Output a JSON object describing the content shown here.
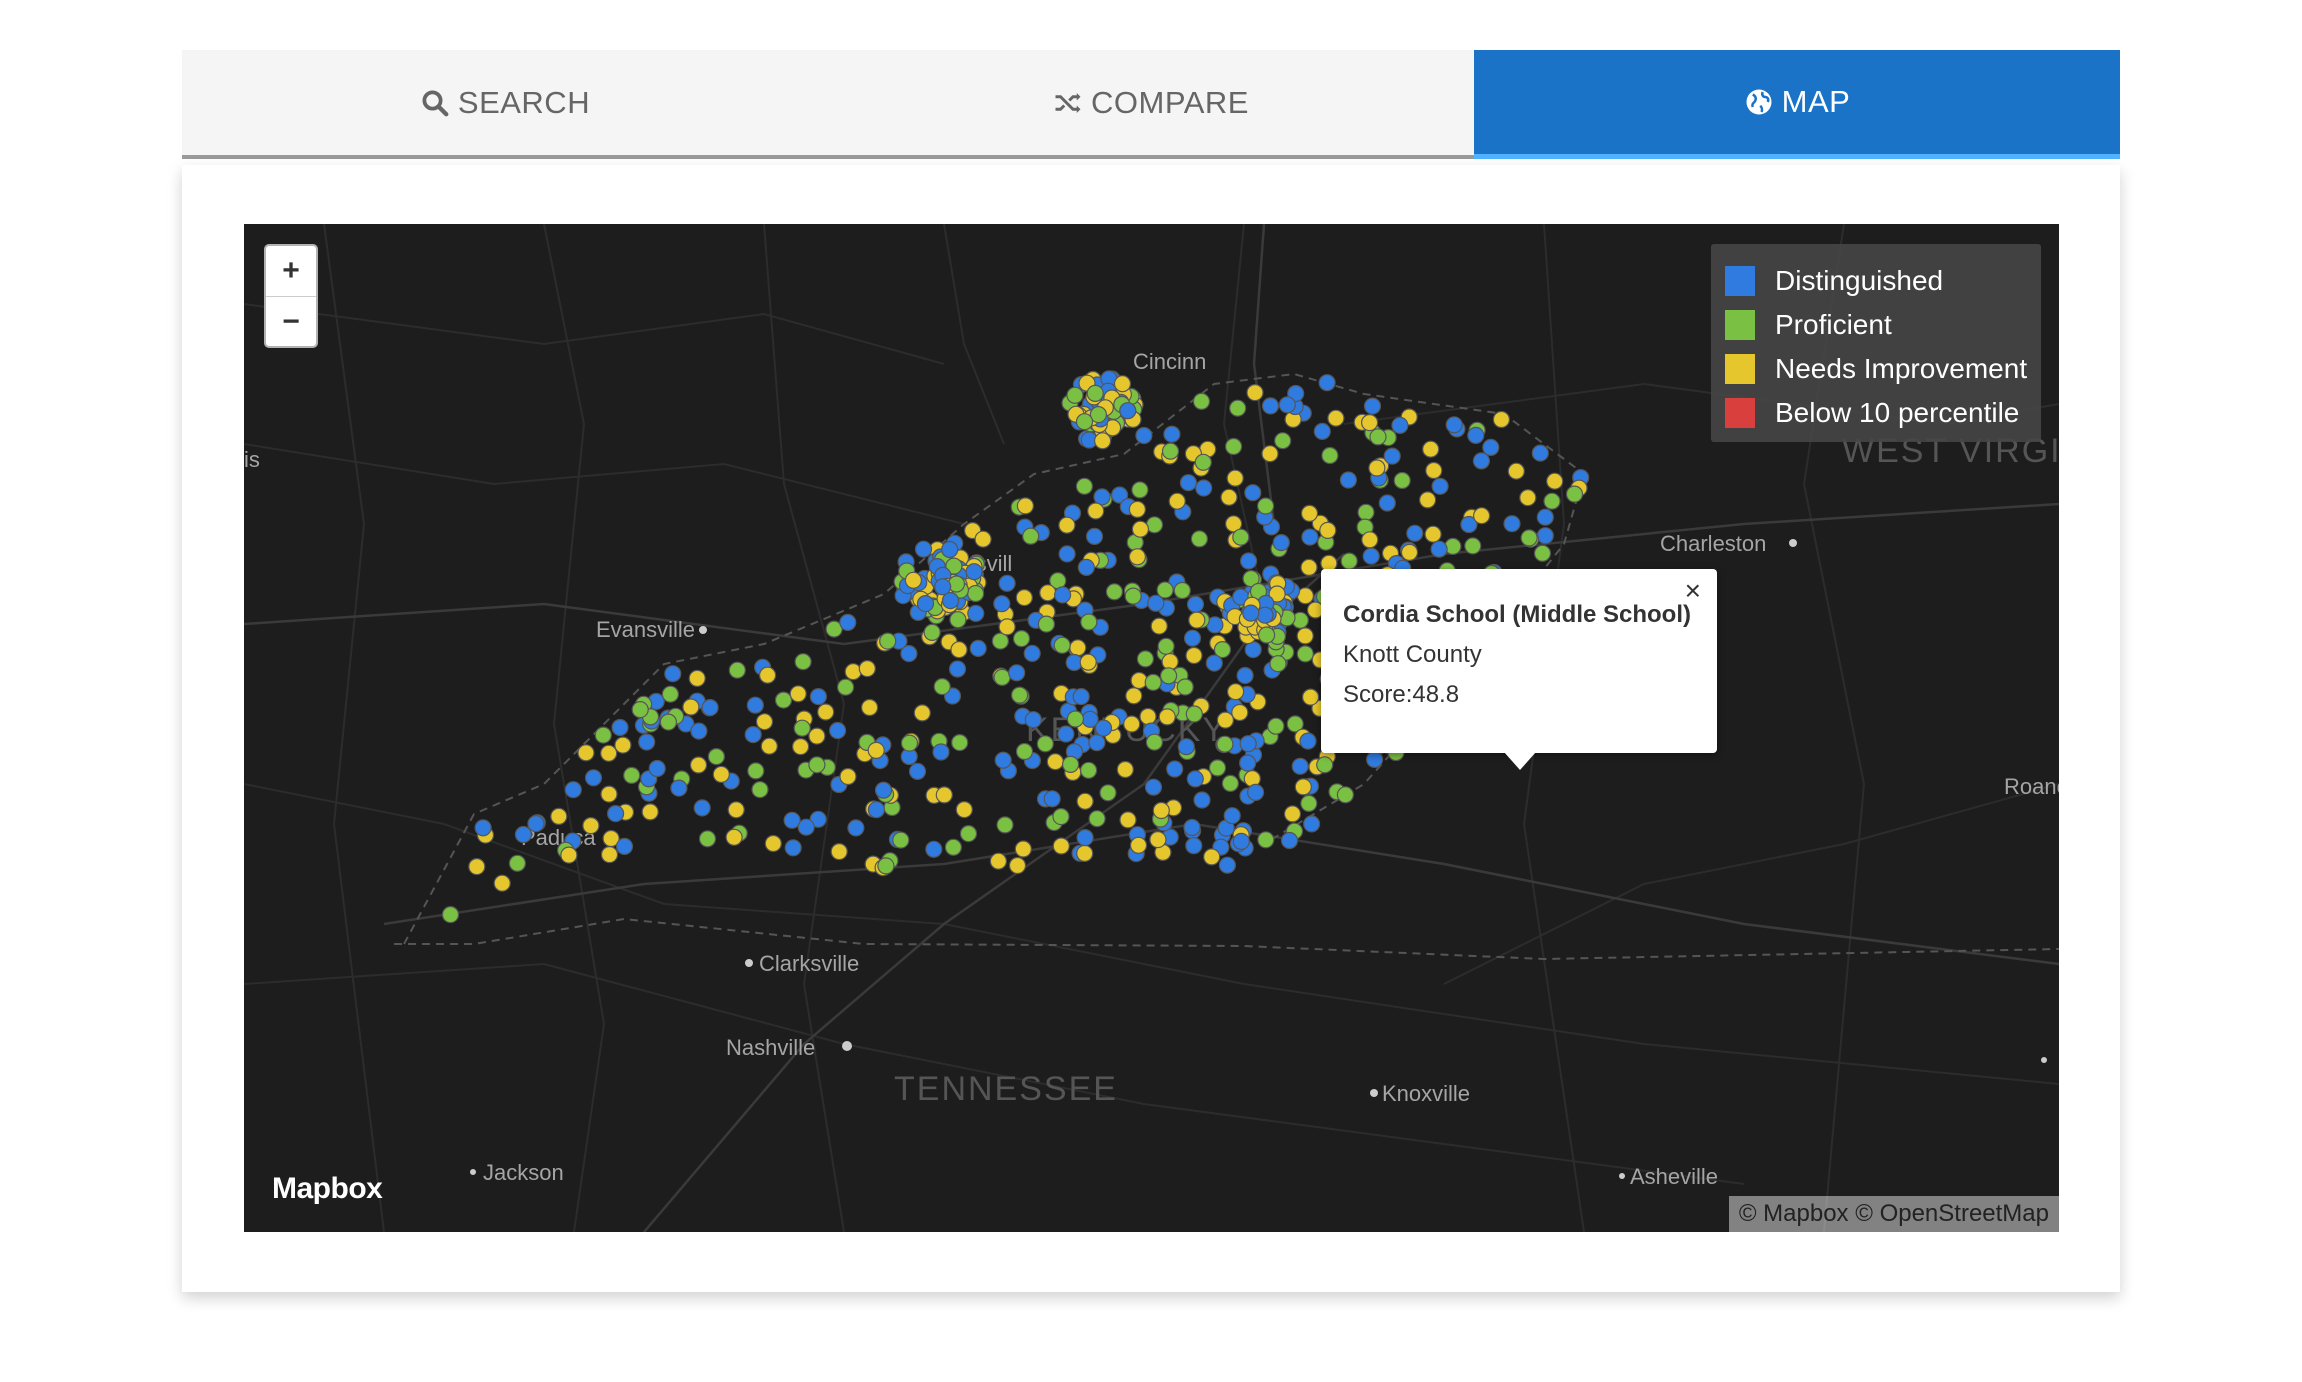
{
  "tabs": [
    {
      "label": "SEARCH",
      "icon": "search-icon",
      "active": false
    },
    {
      "label": "COMPARE",
      "icon": "shuffle-icon",
      "active": false
    },
    {
      "label": "MAP",
      "icon": "globe-icon",
      "active": true
    }
  ],
  "zoom": {
    "in_label": "+",
    "out_label": "−"
  },
  "legend": {
    "items": [
      {
        "label": "Distinguished",
        "color": "#2f7be0"
      },
      {
        "label": "Proficient",
        "color": "#7ac143"
      },
      {
        "label": "Needs Improvement",
        "color": "#e5c72d"
      },
      {
        "label": "Below 10 percentile",
        "color": "#d9403d"
      }
    ]
  },
  "popup": {
    "close_label": "×",
    "school_name": "Cordia School (Middle School)",
    "county": "Knott County",
    "score": "Score:48.8"
  },
  "map_labels": {
    "cities": [
      "Cincinn",
      "Louisvill",
      "Evansville",
      "Charleston",
      "Paduca",
      "Clarksville",
      "Nashville",
      "Knoxville",
      "Jackson",
      "Asheville",
      "Roano",
      "is"
    ],
    "states": [
      "KENTUCKY",
      "TENNESSEE",
      "WEST VIRGINI"
    ]
  },
  "branding": {
    "logo": "Mapbox",
    "attribution": "© Mapbox © OpenStreetMap"
  }
}
